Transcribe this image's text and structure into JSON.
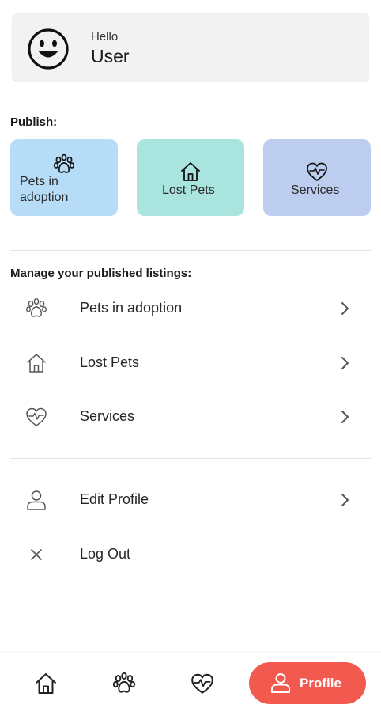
{
  "header": {
    "greeting": "Hello",
    "username": "User"
  },
  "publish": {
    "title": "Publish:",
    "tiles": [
      {
        "label": "Pets in adoption",
        "icon": "paw-icon",
        "color": "#b6dcf7"
      },
      {
        "label": "Lost Pets",
        "icon": "house-icon",
        "color": "#a9e4de"
      },
      {
        "label": "Services",
        "icon": "heart-pulse-icon",
        "color": "#bccdf0"
      }
    ]
  },
  "manage": {
    "title": "Manage your published listings:",
    "items": [
      {
        "label": "Pets in adoption",
        "icon": "paw-icon"
      },
      {
        "label": "Lost Pets",
        "icon": "house-icon"
      },
      {
        "label": "Services",
        "icon": "heart-pulse-icon"
      }
    ]
  },
  "account": {
    "items": [
      {
        "label": "Edit Profile",
        "icon": "user-icon"
      },
      {
        "label": "Log Out",
        "icon": "close-icon"
      }
    ]
  },
  "bottom_nav": {
    "items": [
      {
        "icon": "house-icon"
      },
      {
        "icon": "paw-icon"
      },
      {
        "icon": "heart-pulse-icon"
      }
    ],
    "active": {
      "label": "Profile",
      "icon": "user-icon",
      "color": "#f25a4f"
    }
  }
}
